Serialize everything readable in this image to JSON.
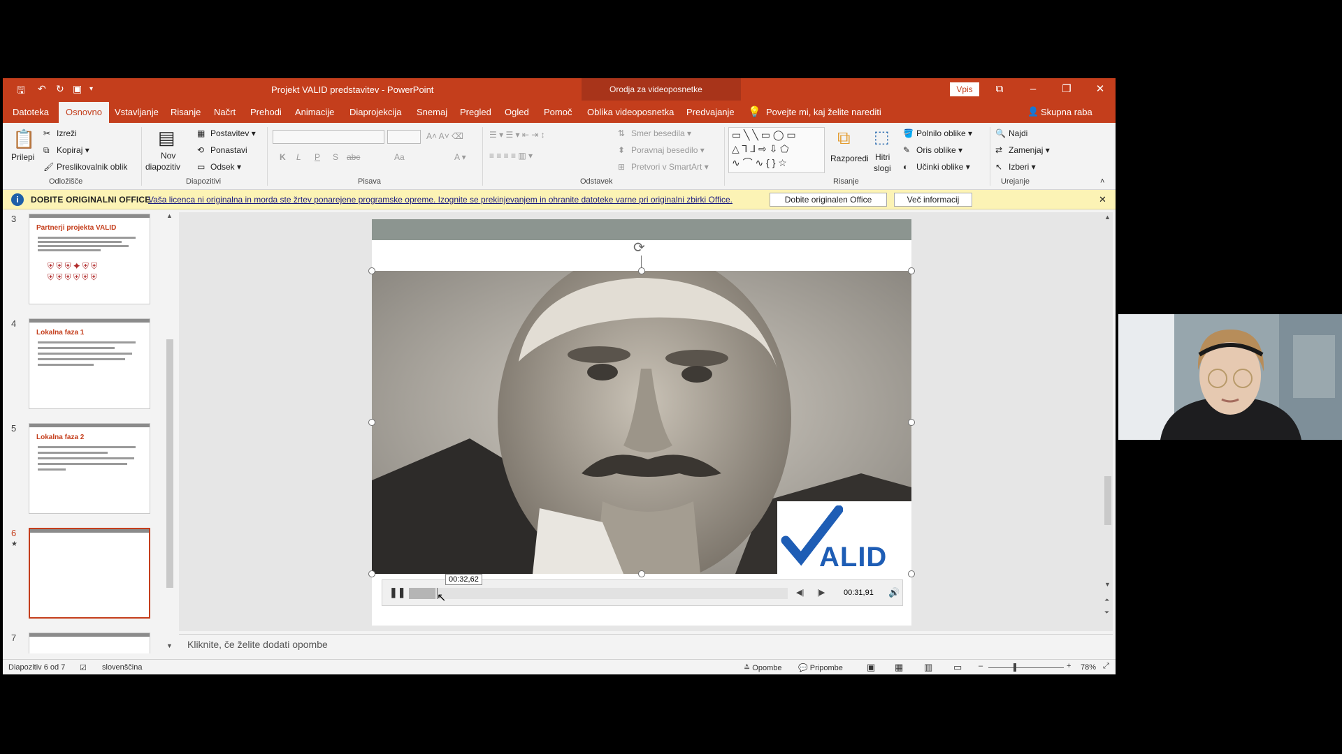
{
  "window": {
    "title": "Projekt VALID predstavitev  -  PowerPoint",
    "context_tool": "Orodja za videoposnetke",
    "signin": "Vpis"
  },
  "tabs": [
    "Datoteka",
    "Osnovno",
    "Vstavljanje",
    "Risanje",
    "Načrt",
    "Prehodi",
    "Animacije",
    "Diaprojekcija",
    "Snemaj",
    "Pregled",
    "Ogled",
    "Pomoč",
    "Oblika videoposnetka",
    "Predvajanje"
  ],
  "active_tab": "Osnovno",
  "tellme": "Povejte mi, kaj želite narediti",
  "share": "Skupna raba",
  "ribbon": {
    "clipboard": {
      "group": "Odložišče",
      "paste": "Prilepi",
      "cut": "Izreži",
      "copy": "Kopiraj",
      "painter": "Preslikovalnik oblik"
    },
    "slides": {
      "group": "Diapozitivi",
      "new_slide_1": "Nov",
      "new_slide_2": "diapozitiv",
      "layout": "Postavitev",
      "reset": "Ponastavi",
      "section": "Odsek"
    },
    "font": {
      "group": "Pisava",
      "bold": "K",
      "italic": "L",
      "underline": "P",
      "shadow": "S",
      "strike": "abc",
      "case": "Aa"
    },
    "paragraph": {
      "group": "Odstavek",
      "text_direction": "Smer besedila",
      "align_text": "Poravnaj besedilo",
      "smartart": "Pretvori v SmartArt"
    },
    "drawing": {
      "group": "Risanje",
      "arrange": "Razporedi",
      "quick_styles_1": "Hitri",
      "quick_styles_2": "slogi",
      "fill": "Polnilo oblike",
      "outline": "Oris oblike",
      "effects": "Učinki oblike"
    },
    "editing": {
      "group": "Urejanje",
      "find": "Najdi",
      "replace": "Zamenjaj",
      "select": "Izberi"
    }
  },
  "warning": {
    "title": "DOBITE ORIGINALNI OFFICE",
    "text": "Vaša licenca ni originalna in morda ste žrtev ponarejene programske opreme. Izognite se prekinjevanjem in ohranite datoteke varne pri originalni zbirki Office.",
    "btn_get": "Dobite originalen Office",
    "btn_more": "Več informacij"
  },
  "thumbnails": [
    {
      "num": "3",
      "title": "Partnerji projekta VALID"
    },
    {
      "num": "4",
      "title": "Lokalna faza 1"
    },
    {
      "num": "5",
      "title": "Lokalna faza 2"
    },
    {
      "num": "6",
      "title": ""
    },
    {
      "num": "7",
      "title": ""
    }
  ],
  "video": {
    "logo_text": "ALID",
    "tooltip_time": "00:32,62",
    "current_time": "00:31,91",
    "progress": 0.07
  },
  "notes": "Kliknite, če želite dodati opombe",
  "status": {
    "slide": "Diapozitiv 6 od 7",
    "language": "slovenščina",
    "notes_btn": "Opombe",
    "comments_btn": "Pripombe",
    "zoom": "78%"
  },
  "colors": {
    "accent": "#c43e1c",
    "logo_blue": "#1e5db5"
  }
}
